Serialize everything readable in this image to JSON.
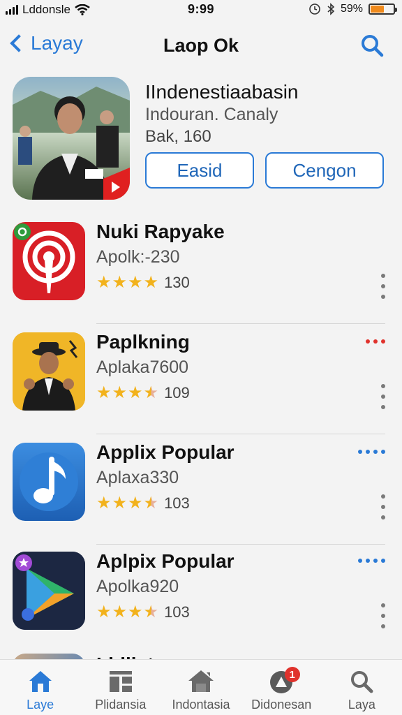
{
  "status_bar": {
    "carrier": "Lddonsle",
    "time": "9:99",
    "battery_percent": "59%",
    "battery_level": 0.59
  },
  "nav": {
    "back_label": "Layay",
    "title": "Laop Ok"
  },
  "featured": {
    "title": "IIndenestiaabasin",
    "subtitle": "Indouran. Canaly",
    "meta": "Bak, 160",
    "buttons": [
      "Easid",
      "Cengon"
    ]
  },
  "apps": [
    {
      "name": "Nuki Rapyake",
      "subtitle": "Apolk:-230",
      "rating": 4,
      "rating_count": "130",
      "icon": "podcast-icon",
      "accent": "#d81f26"
    },
    {
      "name": "Paplkning",
      "subtitle": "Aplaka7600",
      "rating": 3.5,
      "rating_count": "109",
      "icon": "musician-photo-icon",
      "accent": "#e7a21c"
    },
    {
      "name": "Applix Popular",
      "subtitle": "Aplaxa330",
      "rating": 3.5,
      "rating_count": "103",
      "icon": "music-note-icon",
      "accent": "#2a7ad6"
    },
    {
      "name": "Aplpix Popular",
      "subtitle": "Apolka920",
      "rating": 3.5,
      "rating_count": "103",
      "icon": "play-triangle-icon",
      "accent": "#1c2a4a"
    }
  ],
  "peek_row": {
    "name": "Lldlista"
  },
  "tabs": [
    {
      "label": "Laye",
      "icon": "home-icon",
      "active": true
    },
    {
      "label": "Plidansia",
      "icon": "apps-grid-icon",
      "active": false
    },
    {
      "label": "Indontasia",
      "icon": "house-icon",
      "active": false
    },
    {
      "label": "Didonesan",
      "icon": "arcade-icon",
      "active": false,
      "badge": "1"
    },
    {
      "label": "Laya",
      "icon": "search-icon",
      "active": false
    }
  ],
  "colors": {
    "accent": "#2a7ad6",
    "star": "#f2b21c",
    "badge": "#e0322c",
    "more_red": "#e0322c",
    "more_blue": "#2a7ad6"
  }
}
